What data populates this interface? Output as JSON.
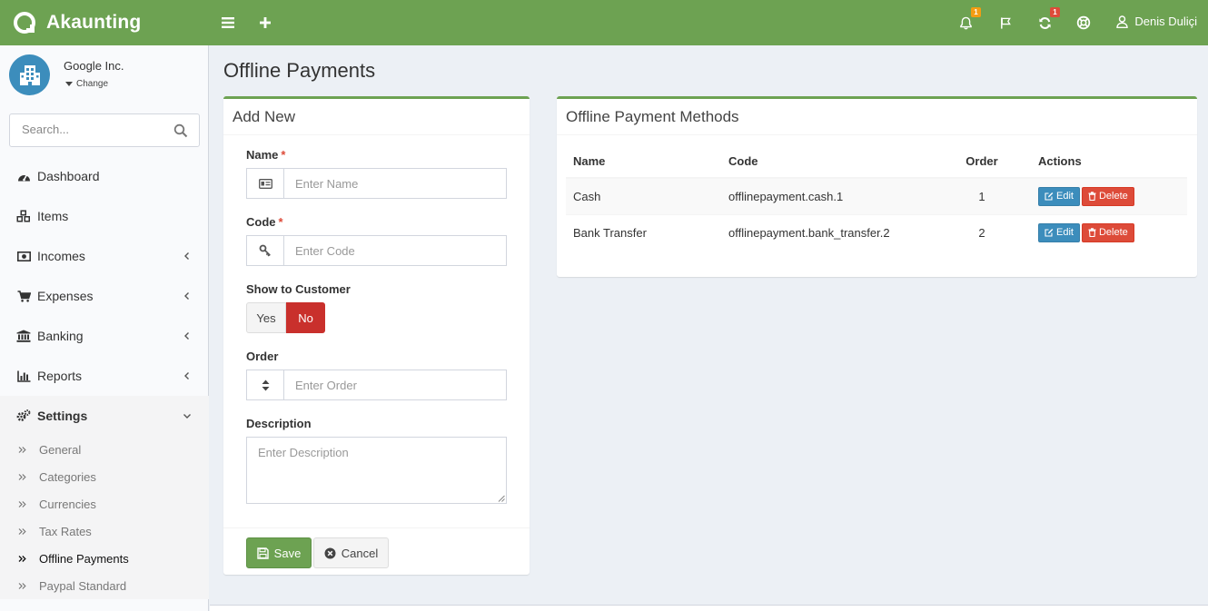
{
  "app": {
    "name": "Akaunting",
    "brand_color": "#6da252"
  },
  "topbar": {
    "notifications_badge": "1",
    "updates_badge": "1",
    "user_name": "Denis Duliçi"
  },
  "company": {
    "name": "Google Inc.",
    "change_label": "Change"
  },
  "search": {
    "placeholder": "Search..."
  },
  "sidebar": {
    "items": [
      {
        "label": "Dashboard",
        "icon": "dashboard-icon"
      },
      {
        "label": "Items",
        "icon": "cubes-icon"
      },
      {
        "label": "Incomes",
        "icon": "money-icon"
      },
      {
        "label": "Expenses",
        "icon": "shopping-cart-icon"
      },
      {
        "label": "Banking",
        "icon": "university-icon"
      },
      {
        "label": "Reports",
        "icon": "bar-chart-icon"
      },
      {
        "label": "Settings",
        "icon": "gears-icon"
      }
    ],
    "settings_sub": [
      "General",
      "Categories",
      "Currencies",
      "Tax Rates",
      "Offline Payments",
      "Paypal Standard"
    ]
  },
  "page": {
    "title": "Offline Payments"
  },
  "add_form": {
    "title": "Add New",
    "name_label": "Name",
    "name_placeholder": "Enter Name",
    "code_label": "Code",
    "code_placeholder": "Enter Code",
    "show_label": "Show to Customer",
    "yes_label": "Yes",
    "no_label": "No",
    "selected": "No",
    "order_label": "Order",
    "order_placeholder": "Enter Order",
    "description_label": "Description",
    "description_placeholder": "Enter Description",
    "save_label": "Save",
    "cancel_label": "Cancel"
  },
  "methods": {
    "title": "Offline Payment Methods",
    "columns": [
      "Name",
      "Code",
      "Order",
      "Actions"
    ],
    "rows": [
      {
        "name": "Cash",
        "code": "offlinepayment.cash.1",
        "order": "1"
      },
      {
        "name": "Bank Transfer",
        "code": "offlinepayment.bank_transfer.2",
        "order": "2"
      }
    ],
    "edit_label": "Edit",
    "delete_label": "Delete"
  }
}
